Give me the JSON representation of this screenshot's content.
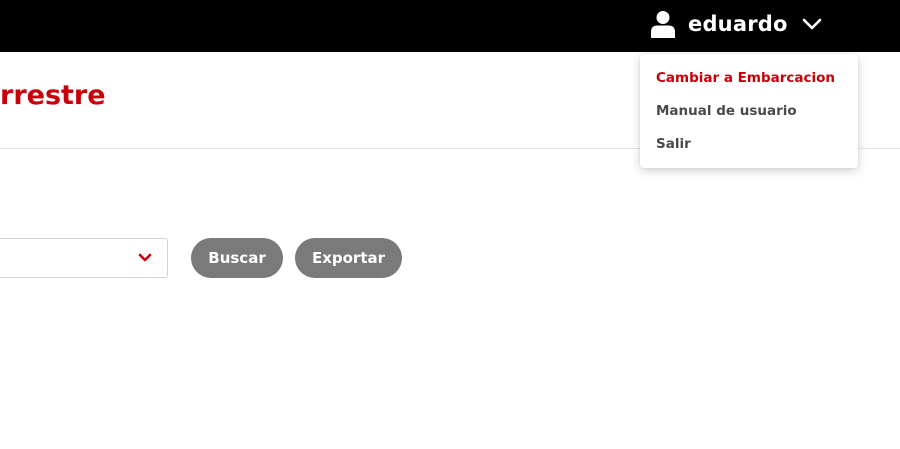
{
  "header": {
    "username": "eduardo",
    "user_icon": "user-icon",
    "toggle_icon": "chevron-down-icon"
  },
  "page": {
    "title": "rrestre"
  },
  "filters": {
    "select_caret_icon": "chevron-down-icon",
    "buscar_label": "Buscar",
    "exportar_label": "Exportar"
  },
  "user_dropdown": {
    "items": [
      {
        "label": "Cambiar a Embarcacion",
        "active": true
      },
      {
        "label": "Manual de usuario",
        "active": false
      },
      {
        "label": "Salir",
        "active": false
      }
    ]
  },
  "colors": {
    "accent": "#c8000a",
    "topbar": "#000000",
    "button": "#7a7a7a",
    "menu_text": "#4a4a4a"
  }
}
